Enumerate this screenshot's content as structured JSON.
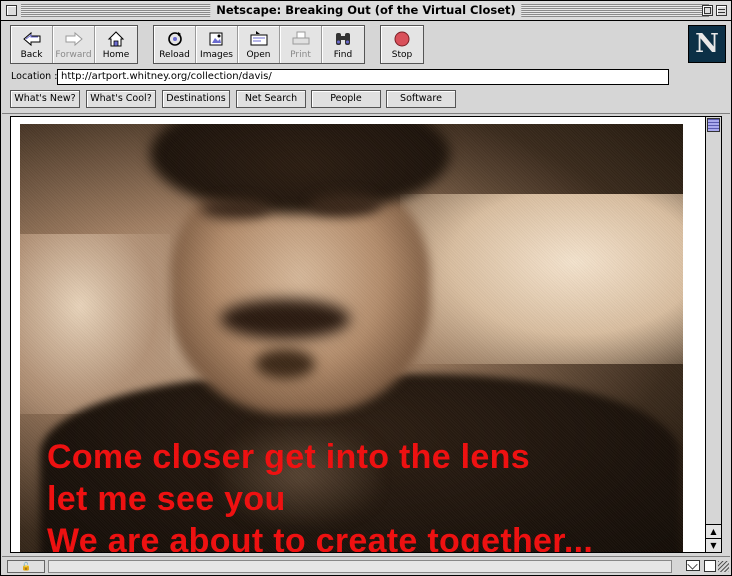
{
  "window": {
    "title": "Netscape: Breaking Out (of the Virtual Closet)"
  },
  "toolbar": {
    "buttons": [
      {
        "label": "Back",
        "icon": "back-arrow-icon"
      },
      {
        "label": "Forward",
        "icon": "forward-arrow-icon",
        "disabled": true
      },
      {
        "label": "Home",
        "icon": "home-icon"
      },
      {
        "label": "Reload",
        "icon": "reload-icon"
      },
      {
        "label": "Images",
        "icon": "images-icon"
      },
      {
        "label": "Open",
        "icon": "open-icon"
      },
      {
        "label": "Print",
        "icon": "print-icon",
        "disabled": true
      },
      {
        "label": "Find",
        "icon": "find-binoculars-icon"
      },
      {
        "label": "Stop",
        "icon": "stop-icon"
      }
    ],
    "logo_letter": "N"
  },
  "location": {
    "label": "Location :",
    "url": "http://artport.whitney.org/collection/davis/"
  },
  "directory": {
    "buttons": [
      "What's New?",
      "What's Cool?",
      "Destinations",
      "Net Search",
      "People",
      "Software"
    ]
  },
  "content": {
    "caption_lines": [
      "Come closer get into the lens",
      "let me see you",
      "We are about to create together..."
    ],
    "caption_color": "#ee1111"
  },
  "colors": {
    "chrome": "#d6d6d6",
    "logo_bg": "#0c3046",
    "stop": "#d9505a",
    "scroll_thumb": "#8c8cd8"
  }
}
